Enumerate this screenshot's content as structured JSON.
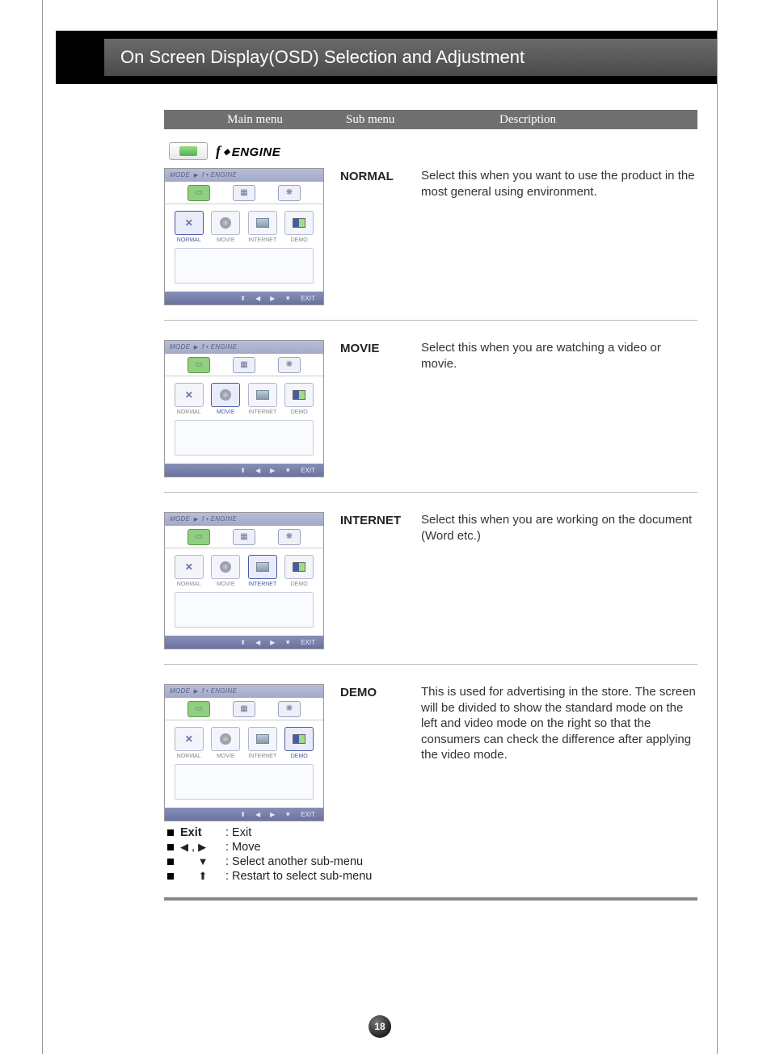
{
  "page_title": "On Screen Display(OSD) Selection and Adjustment",
  "table_headers": {
    "col1": "Main menu",
    "col2": "Sub menu",
    "col3": "Description"
  },
  "engine": {
    "label": "ENGINE",
    "breadcrumb_prefix": "MODE",
    "breadcrumb_item": "f • ENGINE"
  },
  "osd_nav": {
    "up": "⬆",
    "left": "◀",
    "right": "▶",
    "down": "▼",
    "exit": "EXIT"
  },
  "modes": {
    "normal": "NORMAL",
    "movie": "MOVIE",
    "internet": "INTERNET",
    "demo": "DEMO"
  },
  "sections": [
    {
      "submenu": "NORMAL",
      "selected": "normal",
      "description": "Select this when you want to use the product in the most general using environment."
    },
    {
      "submenu": "MOVIE",
      "selected": "movie",
      "description": "Select this when you are watching a video or movie."
    },
    {
      "submenu": "INTERNET",
      "selected": "internet",
      "description": "Select this when you are working on the document (Word etc.)"
    },
    {
      "submenu": "DEMO",
      "selected": "demo",
      "description": "This is used for advertising in the store. The screen will be divided to show the standard mode on the left and video mode on the right so that the consumers can check the difference after applying the video mode."
    }
  ],
  "legend": {
    "exit_key": "Exit",
    "exit_desc": ": Exit",
    "move_desc": ": Move",
    "down_desc": ": Select another sub-menu",
    "up_desc": ": Restart to select sub-menu"
  },
  "page_number": "18"
}
